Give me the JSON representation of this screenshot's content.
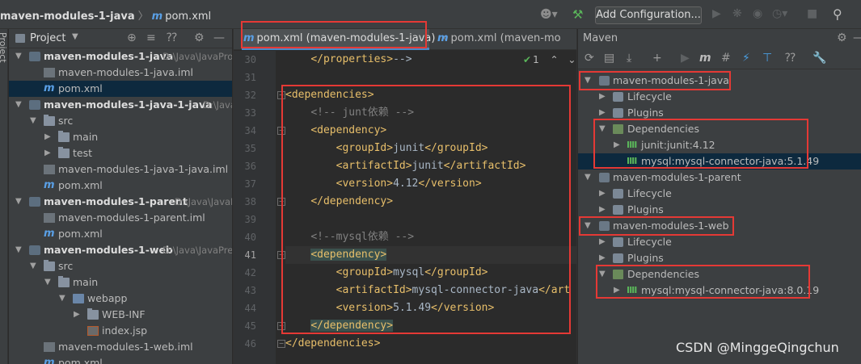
{
  "titlebar": {
    "project": "maven-modules-1-java",
    "file_icon": "m",
    "file": "pom.xml",
    "add_configuration": "Add Configuration..."
  },
  "project_panel": {
    "title": "Project",
    "items": [
      {
        "label": "maven-modules-1-java",
        "path": "D:\\Java\\JavaPro",
        "icon": "module-icon",
        "bold": true
      },
      {
        "label": "maven-modules-1-java.iml",
        "icon": "iml-file-icon"
      },
      {
        "label": "pom.xml",
        "icon": "maven-file-icon"
      },
      {
        "label": "maven-modules-1-java-1-java",
        "path": "D:\\Java\\",
        "icon": "module-icon",
        "bold": true
      },
      {
        "label": "src",
        "icon": "folder-icon"
      },
      {
        "label": "main",
        "icon": "folder-icon"
      },
      {
        "label": "test",
        "icon": "folder-icon"
      },
      {
        "label": "maven-modules-1-java-1-java.iml",
        "icon": "iml-file-icon"
      },
      {
        "label": "pom.xml",
        "icon": "maven-file-icon"
      },
      {
        "label": "maven-modules-1-parent",
        "path": "D:\\Java\\JavaPro",
        "icon": "module-icon",
        "bold": true
      },
      {
        "label": "maven-modules-1-parent.iml",
        "icon": "iml-file-icon"
      },
      {
        "label": "pom.xml",
        "icon": "maven-file-icon"
      },
      {
        "label": "maven-modules-1-web",
        "path": "D:\\Java\\JavaPre",
        "icon": "module-icon",
        "bold": true
      },
      {
        "label": "src",
        "icon": "folder-icon"
      },
      {
        "label": "main",
        "icon": "folder-icon"
      },
      {
        "label": "webapp",
        "icon": "web-folder-icon"
      },
      {
        "label": "WEB-INF",
        "icon": "folder-icon"
      },
      {
        "label": "index.jsp",
        "icon": "jsp-file-icon"
      },
      {
        "label": "maven-modules-1-web.iml",
        "icon": "iml-file-icon"
      },
      {
        "label": "pom.xml",
        "icon": "maven-file-icon"
      }
    ]
  },
  "editor": {
    "tabs": [
      {
        "label": "pom.xml (maven-modules-1-java)",
        "active": true
      },
      {
        "label": "pom.xml (maven-mo"
      }
    ],
    "inspection": "1",
    "lines": [
      {
        "n": "30",
        "text": "    </properties>-->"
      },
      {
        "n": "31",
        "text": ""
      },
      {
        "n": "32",
        "text": "<dependencies>"
      },
      {
        "n": "33",
        "text": "    <!-- junt依赖 -->"
      },
      {
        "n": "34",
        "text": "    <dependency>"
      },
      {
        "n": "35",
        "text": "        <groupId>junit</groupId>"
      },
      {
        "n": "36",
        "text": "        <artifactId>junit</artifactId>"
      },
      {
        "n": "37",
        "text": "        <version>4.12</version>"
      },
      {
        "n": "38",
        "text": "    </dependency>"
      },
      {
        "n": "39",
        "text": ""
      },
      {
        "n": "40",
        "text": "    <!--mysql依赖 -->"
      },
      {
        "n": "41",
        "text": "    <dependency>"
      },
      {
        "n": "42",
        "text": "        <groupId>mysql</groupId>"
      },
      {
        "n": "43",
        "text": "        <artifactId>mysql-connector-java</art"
      },
      {
        "n": "44",
        "text": "        <version>5.1.49</version>"
      },
      {
        "n": "45",
        "text": "    </dependency>"
      },
      {
        "n": "46",
        "text": "</dependencies>"
      }
    ]
  },
  "maven_panel": {
    "title": "Maven",
    "items": [
      {
        "label": "maven-modules-1-java"
      },
      {
        "label": "Lifecycle"
      },
      {
        "label": "Plugins"
      },
      {
        "label": "Dependencies"
      },
      {
        "label": "junit:junit:4.12"
      },
      {
        "label": "mysql:mysql-connector-java:5.1.49"
      },
      {
        "label": "maven-modules-1-parent"
      },
      {
        "label": "Lifecycle"
      },
      {
        "label": "Plugins"
      },
      {
        "label": "maven-modules-1-web"
      },
      {
        "label": "Lifecycle"
      },
      {
        "label": "Plugins"
      },
      {
        "label": "Dependencies"
      },
      {
        "label": "mysql:mysql-connector-java:8.0.19"
      }
    ]
  },
  "watermark": "CSDN @MinggeQingchun",
  "colors": {
    "annotation_red": "#e53935",
    "xml_tag": "#e8bf6a",
    "comment": "#808080",
    "selection": "#0d293e"
  }
}
